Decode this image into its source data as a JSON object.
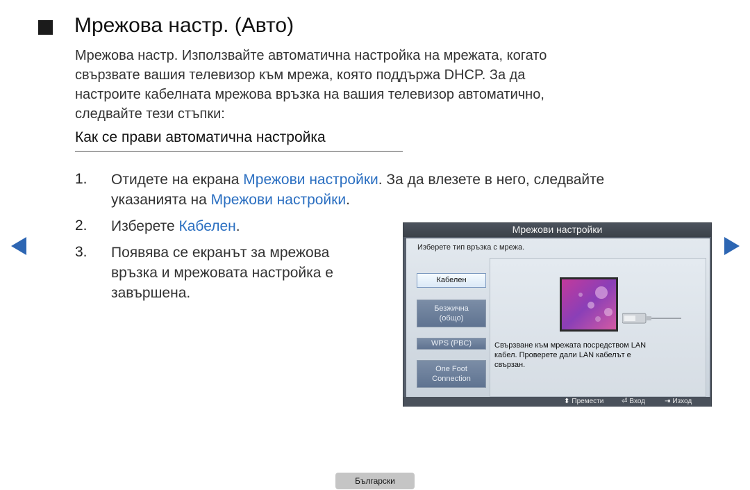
{
  "page": {
    "title": "Мрежова настр. (Авто)",
    "intro": [
      "Мрежова настр. Използвайте автоматична настройка на мрежата, когато",
      "свързвате вашия телевизор към мрежа, която поддържа DHCP. За да",
      "настроите кабелната мрежова връзка на вашия телевизор автоматично,",
      "следвайте тези стъпки:"
    ],
    "subheading": "Как се прави автоматична настройка"
  },
  "steps": [
    {
      "number": "1.",
      "parts": [
        "Отидете на екрана ",
        "Мрежови настройки",
        ". За да влезете в него, следвайте",
        "указанията на ",
        "Мрежови настройки",
        "."
      ]
    },
    {
      "number": "2.",
      "parts": [
        "Изберете ",
        "Кабелен",
        "."
      ]
    },
    {
      "number": "3.",
      "lines": [
        "Появява се екранът за мрежова",
        "връзка и мрежовата настройка е",
        "завършена."
      ]
    }
  ],
  "colors": {
    "highlight": "#2b6fc1",
    "nav_arrow": "#2d66b3"
  },
  "nav": {
    "prev_icon": "arrow-left-icon",
    "next_icon": "arrow-right-icon"
  },
  "tv_screen": {
    "title": "Мрежови настройки",
    "instruction": "Изберете тип връзка с мрежа.",
    "options": [
      {
        "lines": [
          "Кабелен"
        ],
        "selected": true
      },
      {
        "lines": [
          "Безжична",
          "(общо)"
        ],
        "selected": false
      },
      {
        "lines": [
          "WPS (PBC)"
        ],
        "selected": false
      },
      {
        "lines": [
          "One Foot",
          "Connection"
        ],
        "selected": false
      }
    ],
    "description": [
      "Свързване към мрежата посредством LAN",
      "кабел. Проверете дали LAN кабелът е",
      "свързан."
    ],
    "footer": {
      "move": "Премести",
      "enter": "Вход",
      "exit": "Изход",
      "move_icon": "updown-icon",
      "enter_icon": "enter-icon",
      "exit_icon": "exit-icon"
    }
  },
  "footer": {
    "language": "Български"
  }
}
